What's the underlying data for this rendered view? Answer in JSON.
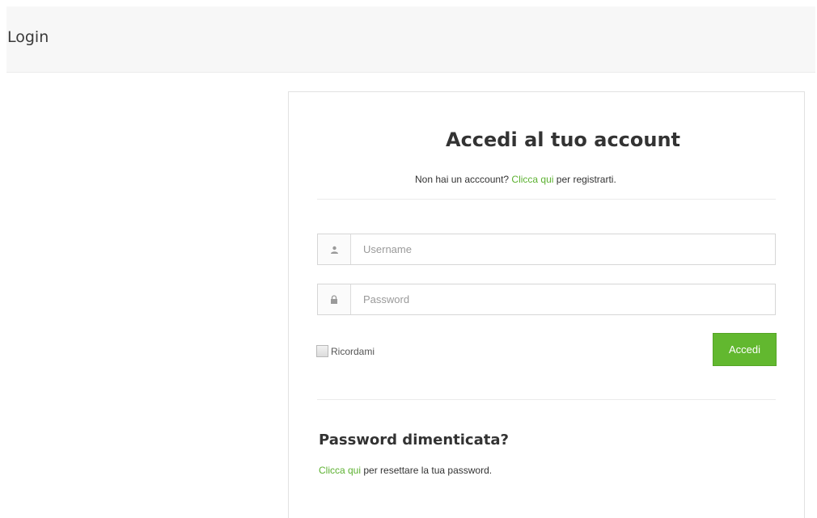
{
  "header": {
    "title": "Login"
  },
  "login": {
    "title": "Accedi al tuo account",
    "register_prefix": "Non hai un acccount? ",
    "register_link": "Clicca qui",
    "register_suffix": " per registrarti.",
    "username_placeholder": "Username",
    "username_value": "",
    "username_icon": "user-icon",
    "password_placeholder": "Password",
    "password_value": "",
    "password_icon": "lock-icon",
    "remember_label": "Ricordami",
    "remember_checked": false,
    "submit_label": "Accedi"
  },
  "forgot": {
    "title": "Password dimenticata?",
    "link": "Clicca qui",
    "suffix": " per resettare la tua password."
  },
  "colors": {
    "accent": "#62b82f",
    "link": "#5cb130",
    "header_bg": "#f7f7f7"
  }
}
